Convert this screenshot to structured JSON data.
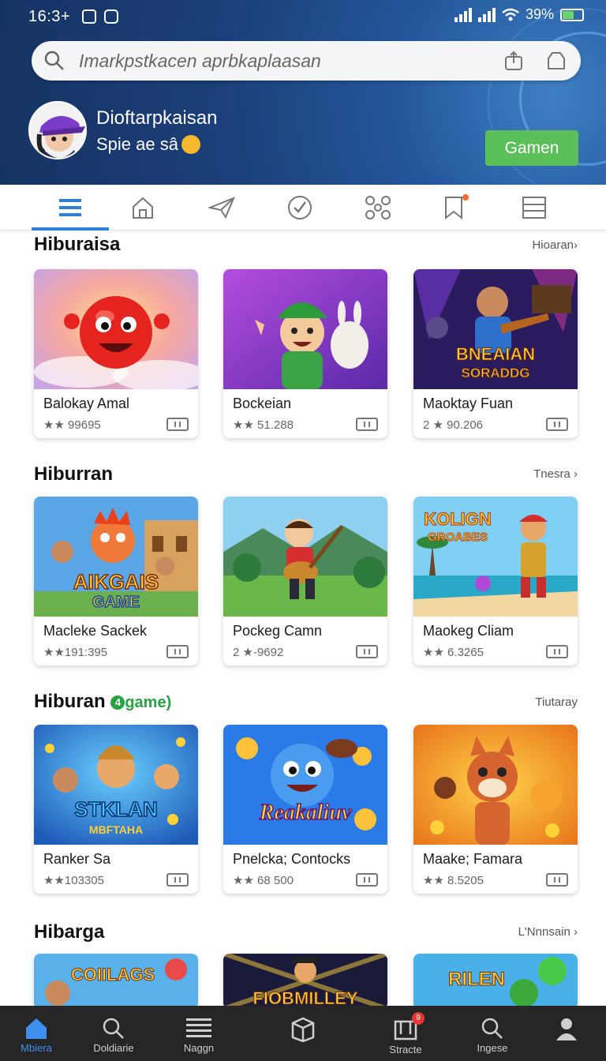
{
  "status_bar": {
    "time": "16:3+",
    "battery": "39%"
  },
  "search": {
    "placeholder": "Imarkpstkacen aprbkaplaasan"
  },
  "profile": {
    "name": "Dioftarpkaisan",
    "subtitle": "Spie ae sâ",
    "button_label": "Gamen"
  },
  "tabs": [
    {
      "icon": "list-icon",
      "active": true
    },
    {
      "icon": "home-icon",
      "active": false
    },
    {
      "icon": "send-icon",
      "active": false
    },
    {
      "icon": "check-circle-icon",
      "active": false
    },
    {
      "icon": "grid-nodes-icon",
      "active": false
    },
    {
      "icon": "bookmark-icon",
      "active": false,
      "badge": true
    },
    {
      "icon": "stack-icon",
      "active": false
    }
  ],
  "sections": [
    {
      "title": "Hiburaisa",
      "more": "Hioaran›",
      "cards": [
        {
          "title": "Balokay Amal",
          "meta": "★★ 99695"
        },
        {
          "title": "Bockeian",
          "meta": "★★ 51.288"
        },
        {
          "title": "Maoktay Fuan",
          "meta": "2 ★ 90.206"
        }
      ]
    },
    {
      "title": "Hiburran",
      "more": "Tnesra ›",
      "cards": [
        {
          "title": "Macleke Sackek",
          "meta": "★★191:395"
        },
        {
          "title": "Pockeg Camn",
          "meta": "2 ★-9692"
        },
        {
          "title": "Maokeg Cliam",
          "meta": "★★ 6.3265"
        }
      ]
    },
    {
      "title": "Hiburan",
      "accent": "game)",
      "more": "Tiutaray",
      "cards": [
        {
          "title": "Ranker Sa",
          "meta": "★★103305"
        },
        {
          "title": "Pnelcka; Contocks",
          "meta": "★★ 68 500"
        },
        {
          "title": "Maake; Famara",
          "meta": "★★ 8.5205"
        }
      ]
    },
    {
      "title": "Hibarga",
      "more": "L'Nnnsain ›",
      "cards": [
        {
          "title": ""
        },
        {
          "title": ""
        },
        {
          "title": ""
        }
      ]
    }
  ],
  "thumb_text": {
    "s0c2": [
      "BNEAIAN",
      "SORADDG"
    ],
    "s1c0": [
      "AIKGAIS",
      "GAME"
    ],
    "s1c2": [
      "KOLIGN",
      "GROABES"
    ],
    "s2c0": [
      "STKLAN",
      "MBFTAHA"
    ],
    "s2c1": [
      "Reakaliuv"
    ],
    "s3c0": [
      "COIILAGS"
    ],
    "s3c1": [
      "FIOBMILLEY"
    ],
    "s3c2": [
      "RILEN"
    ]
  },
  "bottom_nav": [
    {
      "label": "Mbiera",
      "icon": "home-icon",
      "active": true
    },
    {
      "label": "Doldiarie",
      "icon": "search-icon",
      "active": false
    },
    {
      "label": "Naggn",
      "icon": "menu-icon",
      "active": false
    },
    {
      "label": "",
      "icon": "box-icon",
      "active": false
    },
    {
      "label": "Stracte",
      "icon": "store-icon",
      "active": false,
      "badge": "9"
    },
    {
      "label": "Ingese",
      "icon": "search-icon",
      "active": false
    },
    {
      "label": "",
      "icon": "user-icon",
      "active": false
    }
  ],
  "colors": {
    "accent": "#2f7fd6",
    "button": "#5bbf5a",
    "header": "#1b3f78",
    "bottom_nav": "#262626"
  }
}
